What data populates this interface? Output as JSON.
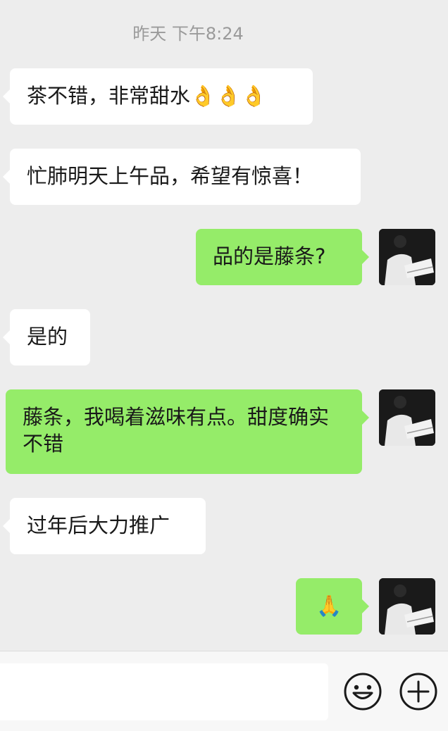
{
  "timestamp": "昨天 下午8:24",
  "messages": [
    {
      "side": "left",
      "text": "茶不错，非常甜水👌👌👌"
    },
    {
      "side": "left",
      "text": "忙肺明天上午品，希望有惊喜！"
    },
    {
      "side": "right",
      "text": "品的是藤条?"
    },
    {
      "side": "left",
      "text": "是的"
    },
    {
      "side": "right",
      "text": "藤条，我喝着滋味有点。甜度确实不错"
    },
    {
      "side": "left",
      "text": "过年后大力推广"
    },
    {
      "side": "right",
      "text": "🙏"
    }
  ],
  "input": {
    "placeholder": ""
  },
  "icons": {
    "emoji": "smiley-icon",
    "more": "plus-circle-icon"
  }
}
